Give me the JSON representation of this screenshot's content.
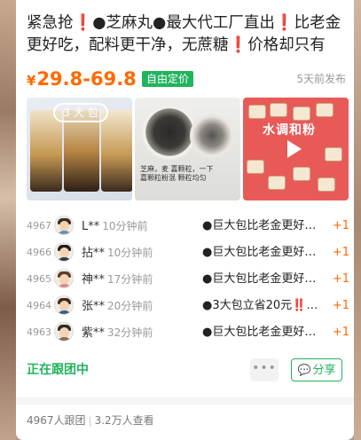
{
  "post": {
    "title": "紧急抢❗●芝麻丸●最大代工厂直出❗比老金更好吃，配料更干净，无蔗糖❗价格却只有⅓❗【呆…",
    "price_currency": "¥",
    "price_range": "29.8-69.8",
    "price_tag": "自由定价",
    "posted_time": "5天前发布"
  },
  "images": {
    "img1_badge": "3 大 包",
    "img2_note_1": "芝麻，麦 嘉颗粒，一下",
    "img2_note_2": "嘉颗粒粉混 颗粒均匀",
    "img3_text": "水调和粉"
  },
  "members": [
    {
      "no": "4967",
      "name": "L**",
      "time": "10分钟前",
      "msg": "●巨大包比老金更好吃…",
      "plus": "+1"
    },
    {
      "no": "4966",
      "name": "拈**",
      "time": "10分钟前",
      "msg": "●巨大包比老金更好吃…",
      "plus": "+1"
    },
    {
      "no": "4965",
      "name": "神**",
      "time": "17分钟前",
      "msg": "●巨大包比老金更好吃…",
      "plus": "+1"
    },
    {
      "no": "4964",
      "name": "张**",
      "time": "20分钟前",
      "msg": "●3大包立省20元‼️…",
      "plus": "+1"
    },
    {
      "no": "4963",
      "name": "紫**",
      "time": "32分钟前",
      "msg": "●巨大包比老金更好吃…",
      "plus": "+1"
    }
  ],
  "actions": {
    "following": "正在跟团中",
    "more": "•••",
    "share": "分享"
  },
  "footer": {
    "joined": "4967人跟团",
    "separator": "|",
    "views": "3.2万人查看"
  },
  "colors": {
    "price": "#ff6a00",
    "accent_green": "#22b35e"
  }
}
